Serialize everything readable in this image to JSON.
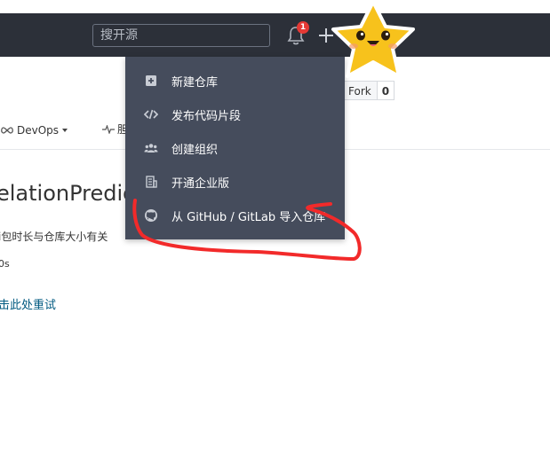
{
  "navbar": {
    "search_placeholder": "搜开源",
    "notification_count": "1"
  },
  "repo": {
    "fork_label": "Fork",
    "fork_count": "0",
    "title": "elationPredic",
    "description": "i包时长与仓库大小有关",
    "time": "0s",
    "retry_link": "击此处重试"
  },
  "subnav": {
    "devops_label": "DevOps",
    "pulse_label": "胆"
  },
  "dropdown": {
    "items": [
      {
        "label": "新建仓库",
        "icon": "plus-square-icon"
      },
      {
        "label": "发布代码片段",
        "icon": "code-icon"
      },
      {
        "label": "创建组织",
        "icon": "users-icon"
      },
      {
        "label": "开通企业版",
        "icon": "building-icon"
      },
      {
        "label": "从 GitHub / GitLab 导入仓库",
        "icon": "github-icon"
      }
    ]
  },
  "colors": {
    "navbar_bg": "#2c3039",
    "dropdown_bg": "#454c5c",
    "badge": "#e53935",
    "annotation_stroke": "#f22a2a",
    "star_fill": "#f7c21c"
  }
}
